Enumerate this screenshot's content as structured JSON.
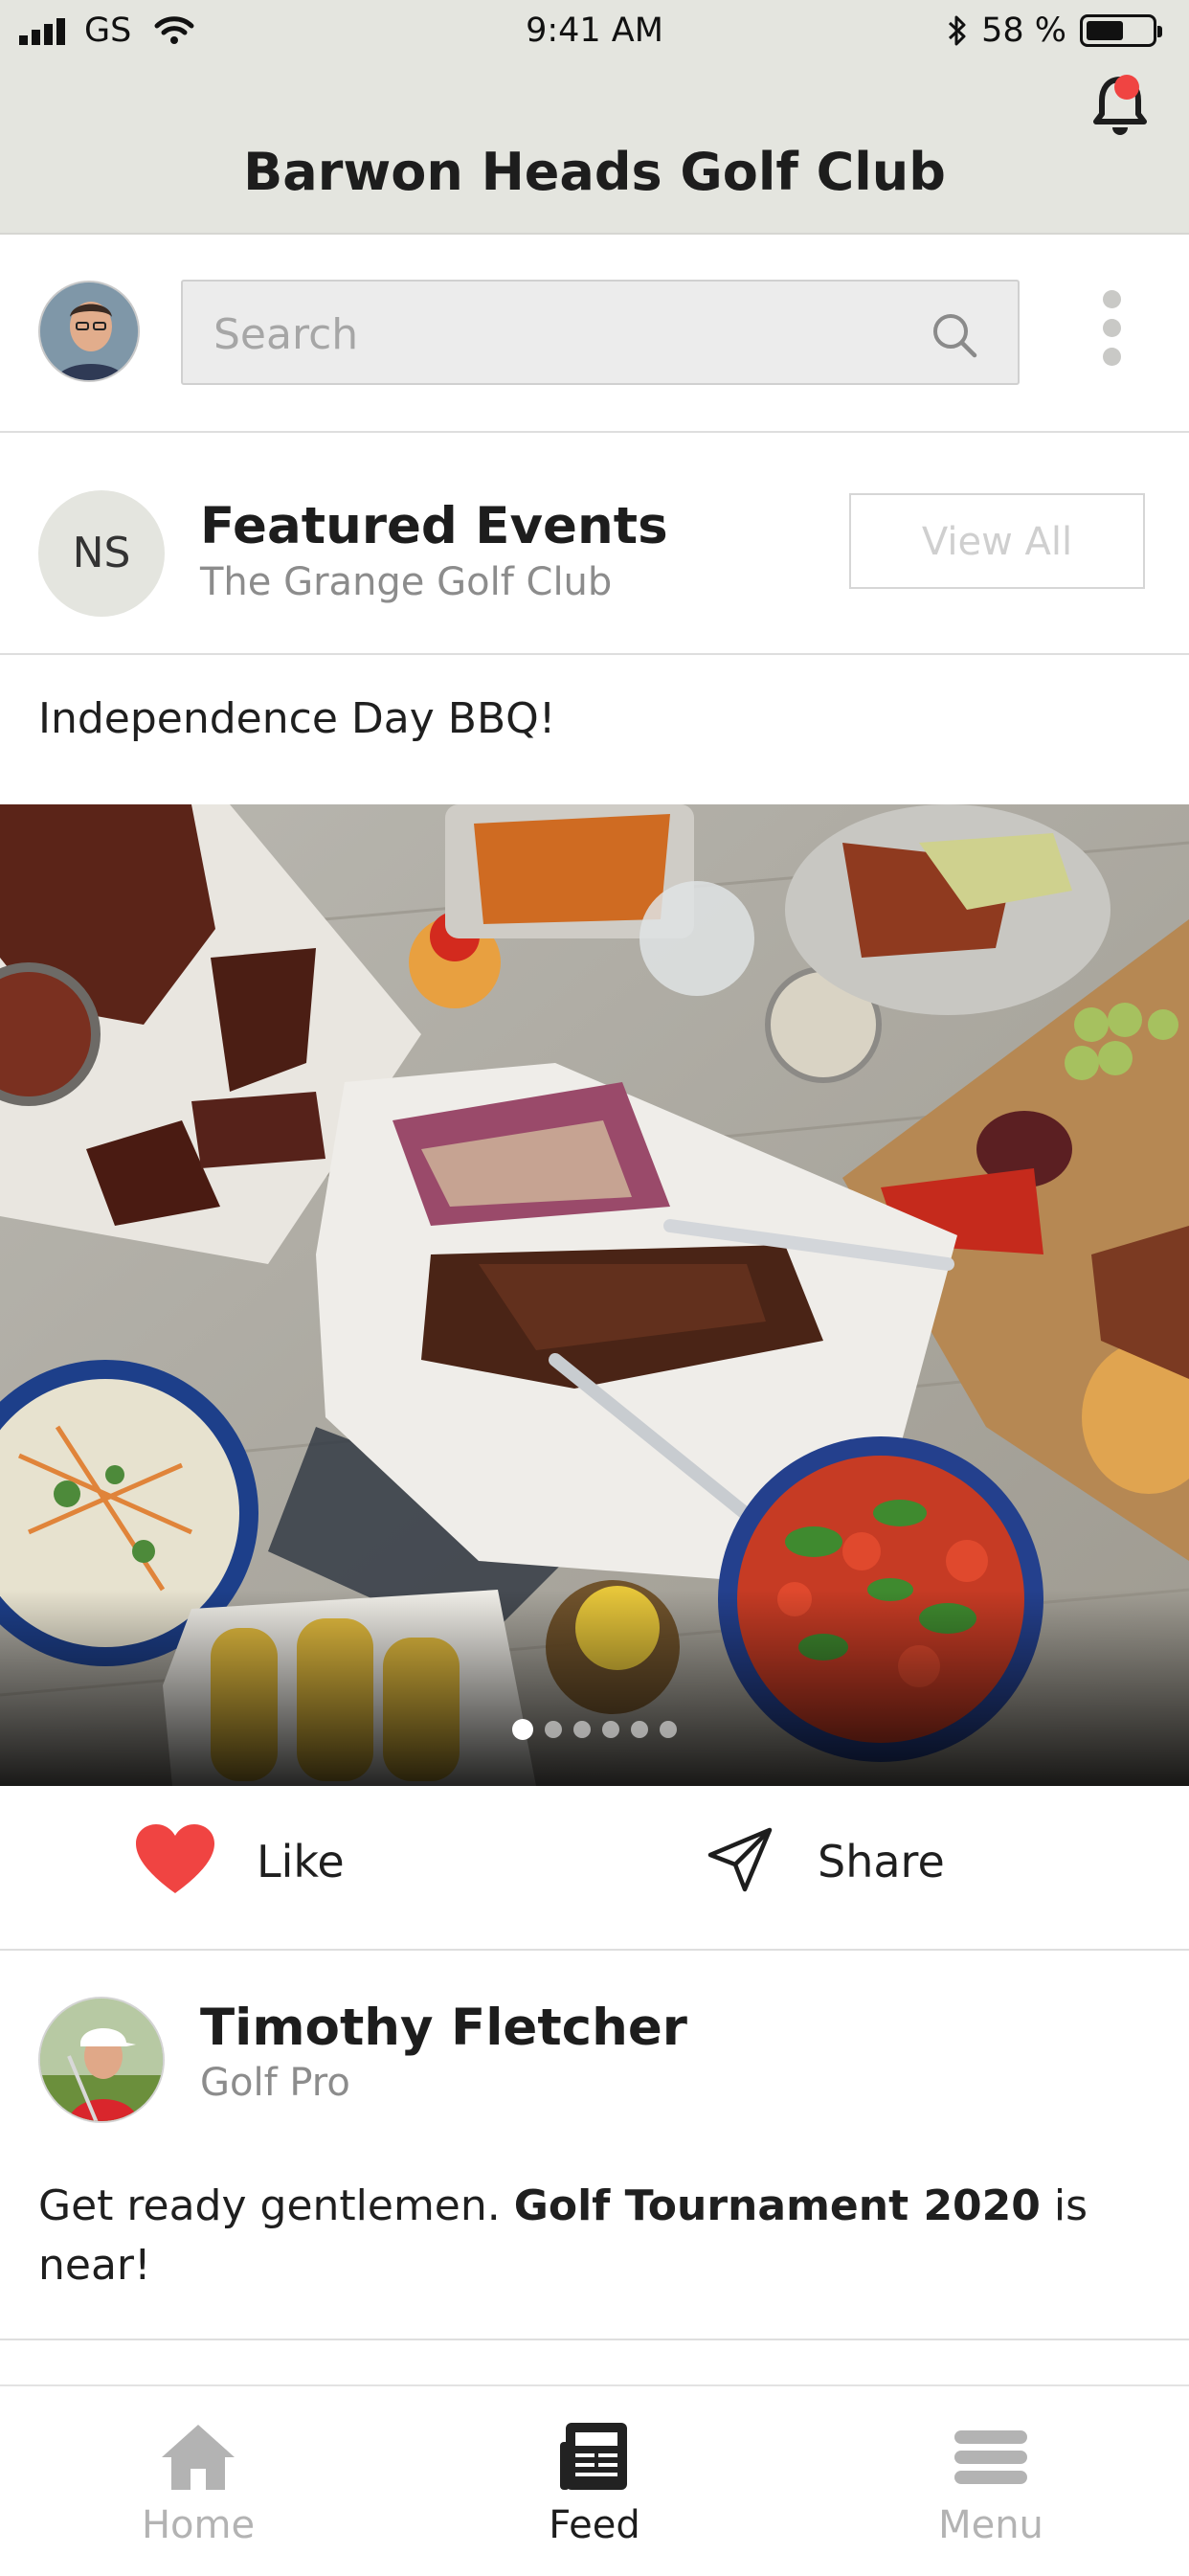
{
  "status_bar": {
    "carrier": "GS",
    "time": "9:41 AM",
    "battery_percent": "58 %",
    "battery_level": 0.58
  },
  "header": {
    "title": "Barwon Heads Golf Club",
    "notification_icon": "bell-icon",
    "notification_dot_color": "#f04442"
  },
  "search": {
    "placeholder": "Search",
    "value": ""
  },
  "featured": {
    "initials": "NS",
    "title": "Featured Events",
    "subtitle": "The Grange Golf Club",
    "view_all_label": "View All"
  },
  "event_post": {
    "text": "Independence Day BBQ!",
    "carousel_total": 6,
    "carousel_active": 1
  },
  "actions": {
    "like_label": "Like",
    "like_color": "#f04442",
    "share_label": "Share"
  },
  "author_post": {
    "name": "Timothy Fletcher",
    "role": "Golf Pro",
    "message_prefix": "Get ready gentlemen. ",
    "message_bold": "Golf Tournament 2020",
    "message_suffix": " is near!"
  },
  "tabbar": {
    "items": [
      {
        "label": "Home",
        "icon": "home-icon",
        "active": false
      },
      {
        "label": "Feed",
        "icon": "newspaper-icon",
        "active": true
      },
      {
        "label": "Menu",
        "icon": "menu-icon",
        "active": false
      }
    ]
  }
}
